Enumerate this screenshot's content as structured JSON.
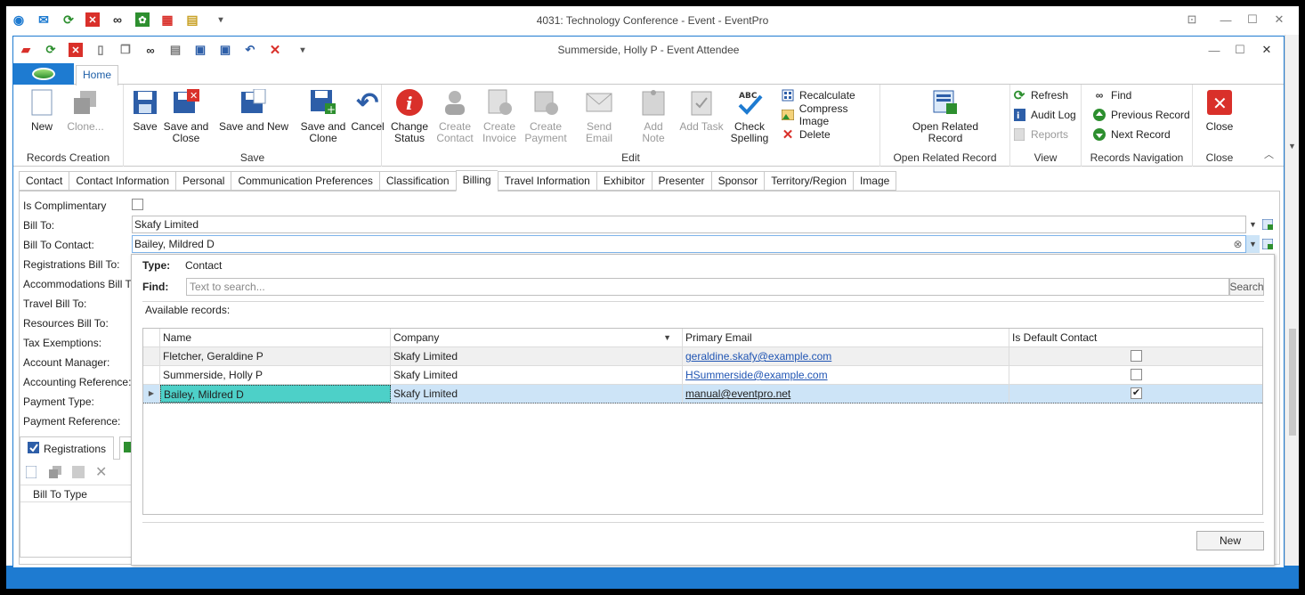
{
  "outer_window": {
    "title": "4031: Technology Conference - Event - EventPro"
  },
  "inner_window": {
    "title": "Summerside, Holly P - Event Attendee"
  },
  "ribbon": {
    "tab_home": "Home",
    "groups": {
      "records_creation": {
        "label": "Records Creation",
        "new": "New",
        "clone": "Clone..."
      },
      "save": {
        "label": "Save",
        "save": "Save",
        "save_and_close": "Save and Close",
        "save_and_new": "Save and New",
        "save_and_clone": "Save and Clone",
        "cancel": "Cancel"
      },
      "edit": {
        "label": "Edit",
        "change_status": "Change Status",
        "create_contact": "Create Contact",
        "create_invoice": "Create Invoice",
        "create_payment": "Create Payment",
        "send_email": "Send Email",
        "add_note": "Add Note",
        "add_task": "Add Task",
        "check_spelling": "Check Spelling",
        "recalculate": "Recalculate",
        "compress_image": "Compress Image",
        "delete": "Delete"
      },
      "open_related": {
        "label": "Open Related Record",
        "open_related_record": "Open Related Record"
      },
      "view": {
        "label": "View",
        "refresh": "Refresh",
        "audit_log": "Audit Log",
        "reports": "Reports"
      },
      "records_navigation": {
        "label": "Records Navigation",
        "find": "Find",
        "previous_record": "Previous Record",
        "next_record": "Next Record"
      },
      "close": {
        "label": "Close",
        "close": "Close"
      }
    }
  },
  "form_tabs": [
    "Contact",
    "Contact Information",
    "Personal",
    "Communication Preferences",
    "Classification",
    "Billing",
    "Travel Information",
    "Exhibitor",
    "Presenter",
    "Sponsor",
    "Territory/Region",
    "Image"
  ],
  "billing": {
    "labels": {
      "is_complimentary": "Is Complimentary",
      "bill_to": "Bill To:",
      "bill_to_contact": "Bill To Contact:",
      "registrations_bill_to": "Registrations Bill To:",
      "accommodations_bill_to": "Accommodations Bill To:",
      "travel_bill_to": "Travel Bill To:",
      "resources_bill_to": "Resources Bill To:",
      "tax_exemptions": "Tax Exemptions:",
      "account_manager": "Account Manager:",
      "accounting_reference": "Accounting Reference:",
      "payment_type": "Payment Type:",
      "payment_reference": "Payment Reference:"
    },
    "bill_to_value": "Skafy Limited",
    "bill_to_contact_value": "Bailey, Mildred D"
  },
  "lower_tabs": {
    "registrations": "Registrations",
    "column_bill_to_type": "Bill To Type"
  },
  "popup": {
    "type_label": "Type:",
    "type_value": "Contact",
    "find_label": "Find:",
    "search_placeholder": "Text to search...",
    "search_button": "Search",
    "available_records": "Available records:",
    "columns": [
      "Name",
      "Company",
      "Primary Email",
      "Is Default Contact"
    ],
    "rows": [
      {
        "name": "Fletcher, Geraldine P",
        "company": "Skafy Limited",
        "email": "geraldine.skafy@example.com",
        "is_default": false
      },
      {
        "name": "Summerside, Holly P",
        "company": "Skafy Limited",
        "email": "HSummerside@example.com",
        "is_default": false
      },
      {
        "name": "Bailey, Mildred D",
        "company": "Skafy Limited",
        "email": "manual@eventpro.net",
        "is_default": true
      }
    ],
    "new_button": "New"
  },
  "colors": {
    "accent_blue": "#1e7bd1",
    "selected_row": "#cde4f7",
    "selected_cell": "#4dd0c8",
    "link": "#1f54b3"
  }
}
